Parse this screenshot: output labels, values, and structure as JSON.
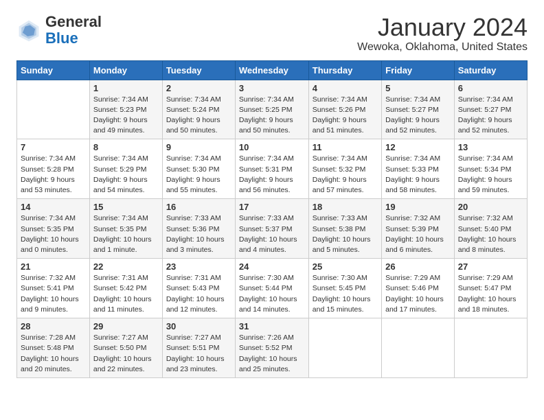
{
  "header": {
    "logo_general": "General",
    "logo_blue": "Blue",
    "month": "January 2024",
    "location": "Wewoka, Oklahoma, United States"
  },
  "days_of_week": [
    "Sunday",
    "Monday",
    "Tuesday",
    "Wednesday",
    "Thursday",
    "Friday",
    "Saturday"
  ],
  "weeks": [
    [
      {
        "day": "",
        "info": ""
      },
      {
        "day": "1",
        "info": "Sunrise: 7:34 AM\nSunset: 5:23 PM\nDaylight: 9 hours\nand 49 minutes."
      },
      {
        "day": "2",
        "info": "Sunrise: 7:34 AM\nSunset: 5:24 PM\nDaylight: 9 hours\nand 50 minutes."
      },
      {
        "day": "3",
        "info": "Sunrise: 7:34 AM\nSunset: 5:25 PM\nDaylight: 9 hours\nand 50 minutes."
      },
      {
        "day": "4",
        "info": "Sunrise: 7:34 AM\nSunset: 5:26 PM\nDaylight: 9 hours\nand 51 minutes."
      },
      {
        "day": "5",
        "info": "Sunrise: 7:34 AM\nSunset: 5:27 PM\nDaylight: 9 hours\nand 52 minutes."
      },
      {
        "day": "6",
        "info": "Sunrise: 7:34 AM\nSunset: 5:27 PM\nDaylight: 9 hours\nand 52 minutes."
      }
    ],
    [
      {
        "day": "7",
        "info": "Sunrise: 7:34 AM\nSunset: 5:28 PM\nDaylight: 9 hours\nand 53 minutes."
      },
      {
        "day": "8",
        "info": "Sunrise: 7:34 AM\nSunset: 5:29 PM\nDaylight: 9 hours\nand 54 minutes."
      },
      {
        "day": "9",
        "info": "Sunrise: 7:34 AM\nSunset: 5:30 PM\nDaylight: 9 hours\nand 55 minutes."
      },
      {
        "day": "10",
        "info": "Sunrise: 7:34 AM\nSunset: 5:31 PM\nDaylight: 9 hours\nand 56 minutes."
      },
      {
        "day": "11",
        "info": "Sunrise: 7:34 AM\nSunset: 5:32 PM\nDaylight: 9 hours\nand 57 minutes."
      },
      {
        "day": "12",
        "info": "Sunrise: 7:34 AM\nSunset: 5:33 PM\nDaylight: 9 hours\nand 58 minutes."
      },
      {
        "day": "13",
        "info": "Sunrise: 7:34 AM\nSunset: 5:34 PM\nDaylight: 9 hours\nand 59 minutes."
      }
    ],
    [
      {
        "day": "14",
        "info": "Sunrise: 7:34 AM\nSunset: 5:35 PM\nDaylight: 10 hours\nand 0 minutes."
      },
      {
        "day": "15",
        "info": "Sunrise: 7:34 AM\nSunset: 5:35 PM\nDaylight: 10 hours\nand 1 minute."
      },
      {
        "day": "16",
        "info": "Sunrise: 7:33 AM\nSunset: 5:36 PM\nDaylight: 10 hours\nand 3 minutes."
      },
      {
        "day": "17",
        "info": "Sunrise: 7:33 AM\nSunset: 5:37 PM\nDaylight: 10 hours\nand 4 minutes."
      },
      {
        "day": "18",
        "info": "Sunrise: 7:33 AM\nSunset: 5:38 PM\nDaylight: 10 hours\nand 5 minutes."
      },
      {
        "day": "19",
        "info": "Sunrise: 7:32 AM\nSunset: 5:39 PM\nDaylight: 10 hours\nand 6 minutes."
      },
      {
        "day": "20",
        "info": "Sunrise: 7:32 AM\nSunset: 5:40 PM\nDaylight: 10 hours\nand 8 minutes."
      }
    ],
    [
      {
        "day": "21",
        "info": "Sunrise: 7:32 AM\nSunset: 5:41 PM\nDaylight: 10 hours\nand 9 minutes."
      },
      {
        "day": "22",
        "info": "Sunrise: 7:31 AM\nSunset: 5:42 PM\nDaylight: 10 hours\nand 11 minutes."
      },
      {
        "day": "23",
        "info": "Sunrise: 7:31 AM\nSunset: 5:43 PM\nDaylight: 10 hours\nand 12 minutes."
      },
      {
        "day": "24",
        "info": "Sunrise: 7:30 AM\nSunset: 5:44 PM\nDaylight: 10 hours\nand 14 minutes."
      },
      {
        "day": "25",
        "info": "Sunrise: 7:30 AM\nSunset: 5:45 PM\nDaylight: 10 hours\nand 15 minutes."
      },
      {
        "day": "26",
        "info": "Sunrise: 7:29 AM\nSunset: 5:46 PM\nDaylight: 10 hours\nand 17 minutes."
      },
      {
        "day": "27",
        "info": "Sunrise: 7:29 AM\nSunset: 5:47 PM\nDaylight: 10 hours\nand 18 minutes."
      }
    ],
    [
      {
        "day": "28",
        "info": "Sunrise: 7:28 AM\nSunset: 5:48 PM\nDaylight: 10 hours\nand 20 minutes."
      },
      {
        "day": "29",
        "info": "Sunrise: 7:27 AM\nSunset: 5:50 PM\nDaylight: 10 hours\nand 22 minutes."
      },
      {
        "day": "30",
        "info": "Sunrise: 7:27 AM\nSunset: 5:51 PM\nDaylight: 10 hours\nand 23 minutes."
      },
      {
        "day": "31",
        "info": "Sunrise: 7:26 AM\nSunset: 5:52 PM\nDaylight: 10 hours\nand 25 minutes."
      },
      {
        "day": "",
        "info": ""
      },
      {
        "day": "",
        "info": ""
      },
      {
        "day": "",
        "info": ""
      }
    ]
  ]
}
